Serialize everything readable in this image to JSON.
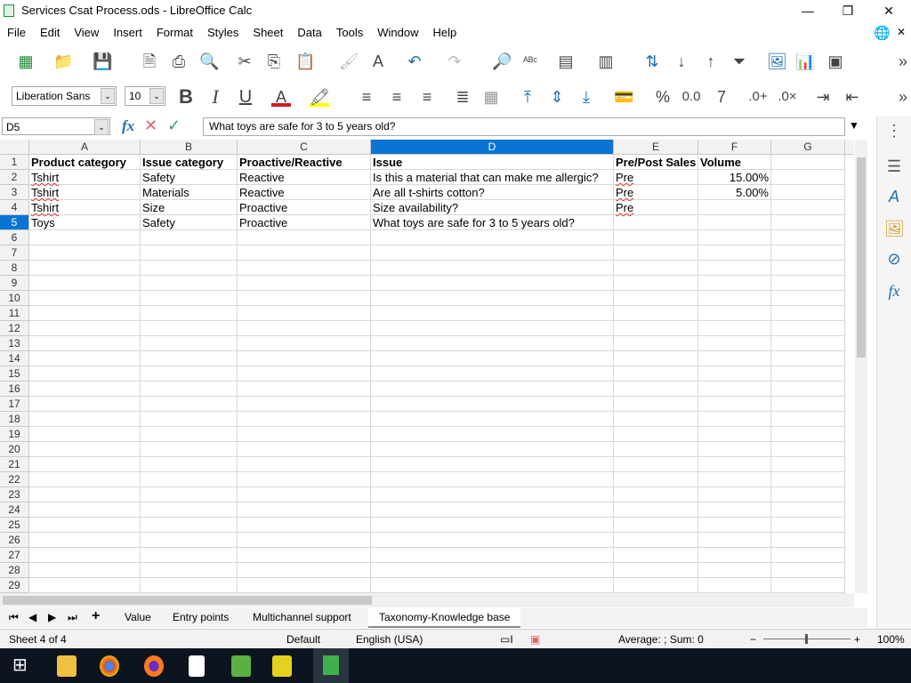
{
  "window": {
    "title": "Services Csat Process.ods - LibreOffice Calc"
  },
  "menu": [
    "File",
    "Edit",
    "View",
    "Insert",
    "Format",
    "Styles",
    "Sheet",
    "Data",
    "Tools",
    "Window",
    "Help"
  ],
  "format": {
    "font": "Liberation Sans",
    "size": "10"
  },
  "formula": {
    "cell_ref": "D5",
    "content": "What toys are safe for 3 to 5 years old?"
  },
  "columns": [
    "A",
    "B",
    "C",
    "D",
    "E",
    "F",
    "G"
  ],
  "active": {
    "col": "D",
    "row": 5
  },
  "rows": [
    [
      "Product category",
      "Issue category",
      "Proactive/Reactive",
      "Issue",
      "Pre/Post Sales",
      "Volume",
      ""
    ],
    [
      "Tshirt",
      "Safety",
      "Reactive",
      "Is this a material that can make me allergic?",
      "Pre",
      "15.00%",
      ""
    ],
    [
      "Tshirt",
      "Materials",
      "Reactive",
      "Are all t-shirts cotton?",
      "Pre",
      "5.00%",
      ""
    ],
    [
      "Tshirt",
      "Size",
      "Proactive",
      "Size availability?",
      "Pre",
      "",
      ""
    ],
    [
      "Toys",
      "Safety",
      "Proactive",
      "What toys are safe for 3 to 5 years old?",
      "",
      "",
      ""
    ]
  ],
  "row_count": 29,
  "sheet_tabs": [
    "Value",
    "Entry points",
    "Multichannel support",
    "Taxonomy-Knowledge base"
  ],
  "active_tab": "Taxonomy-Knowledge base",
  "status": {
    "sheet": "Sheet 4 of 4",
    "style": "Default",
    "language": "English (USA)",
    "summary": "Average: ; Sum: 0",
    "zoom": "100%"
  },
  "colors": {
    "accent": "#0a74d4",
    "taskbar": "#0c1420"
  }
}
